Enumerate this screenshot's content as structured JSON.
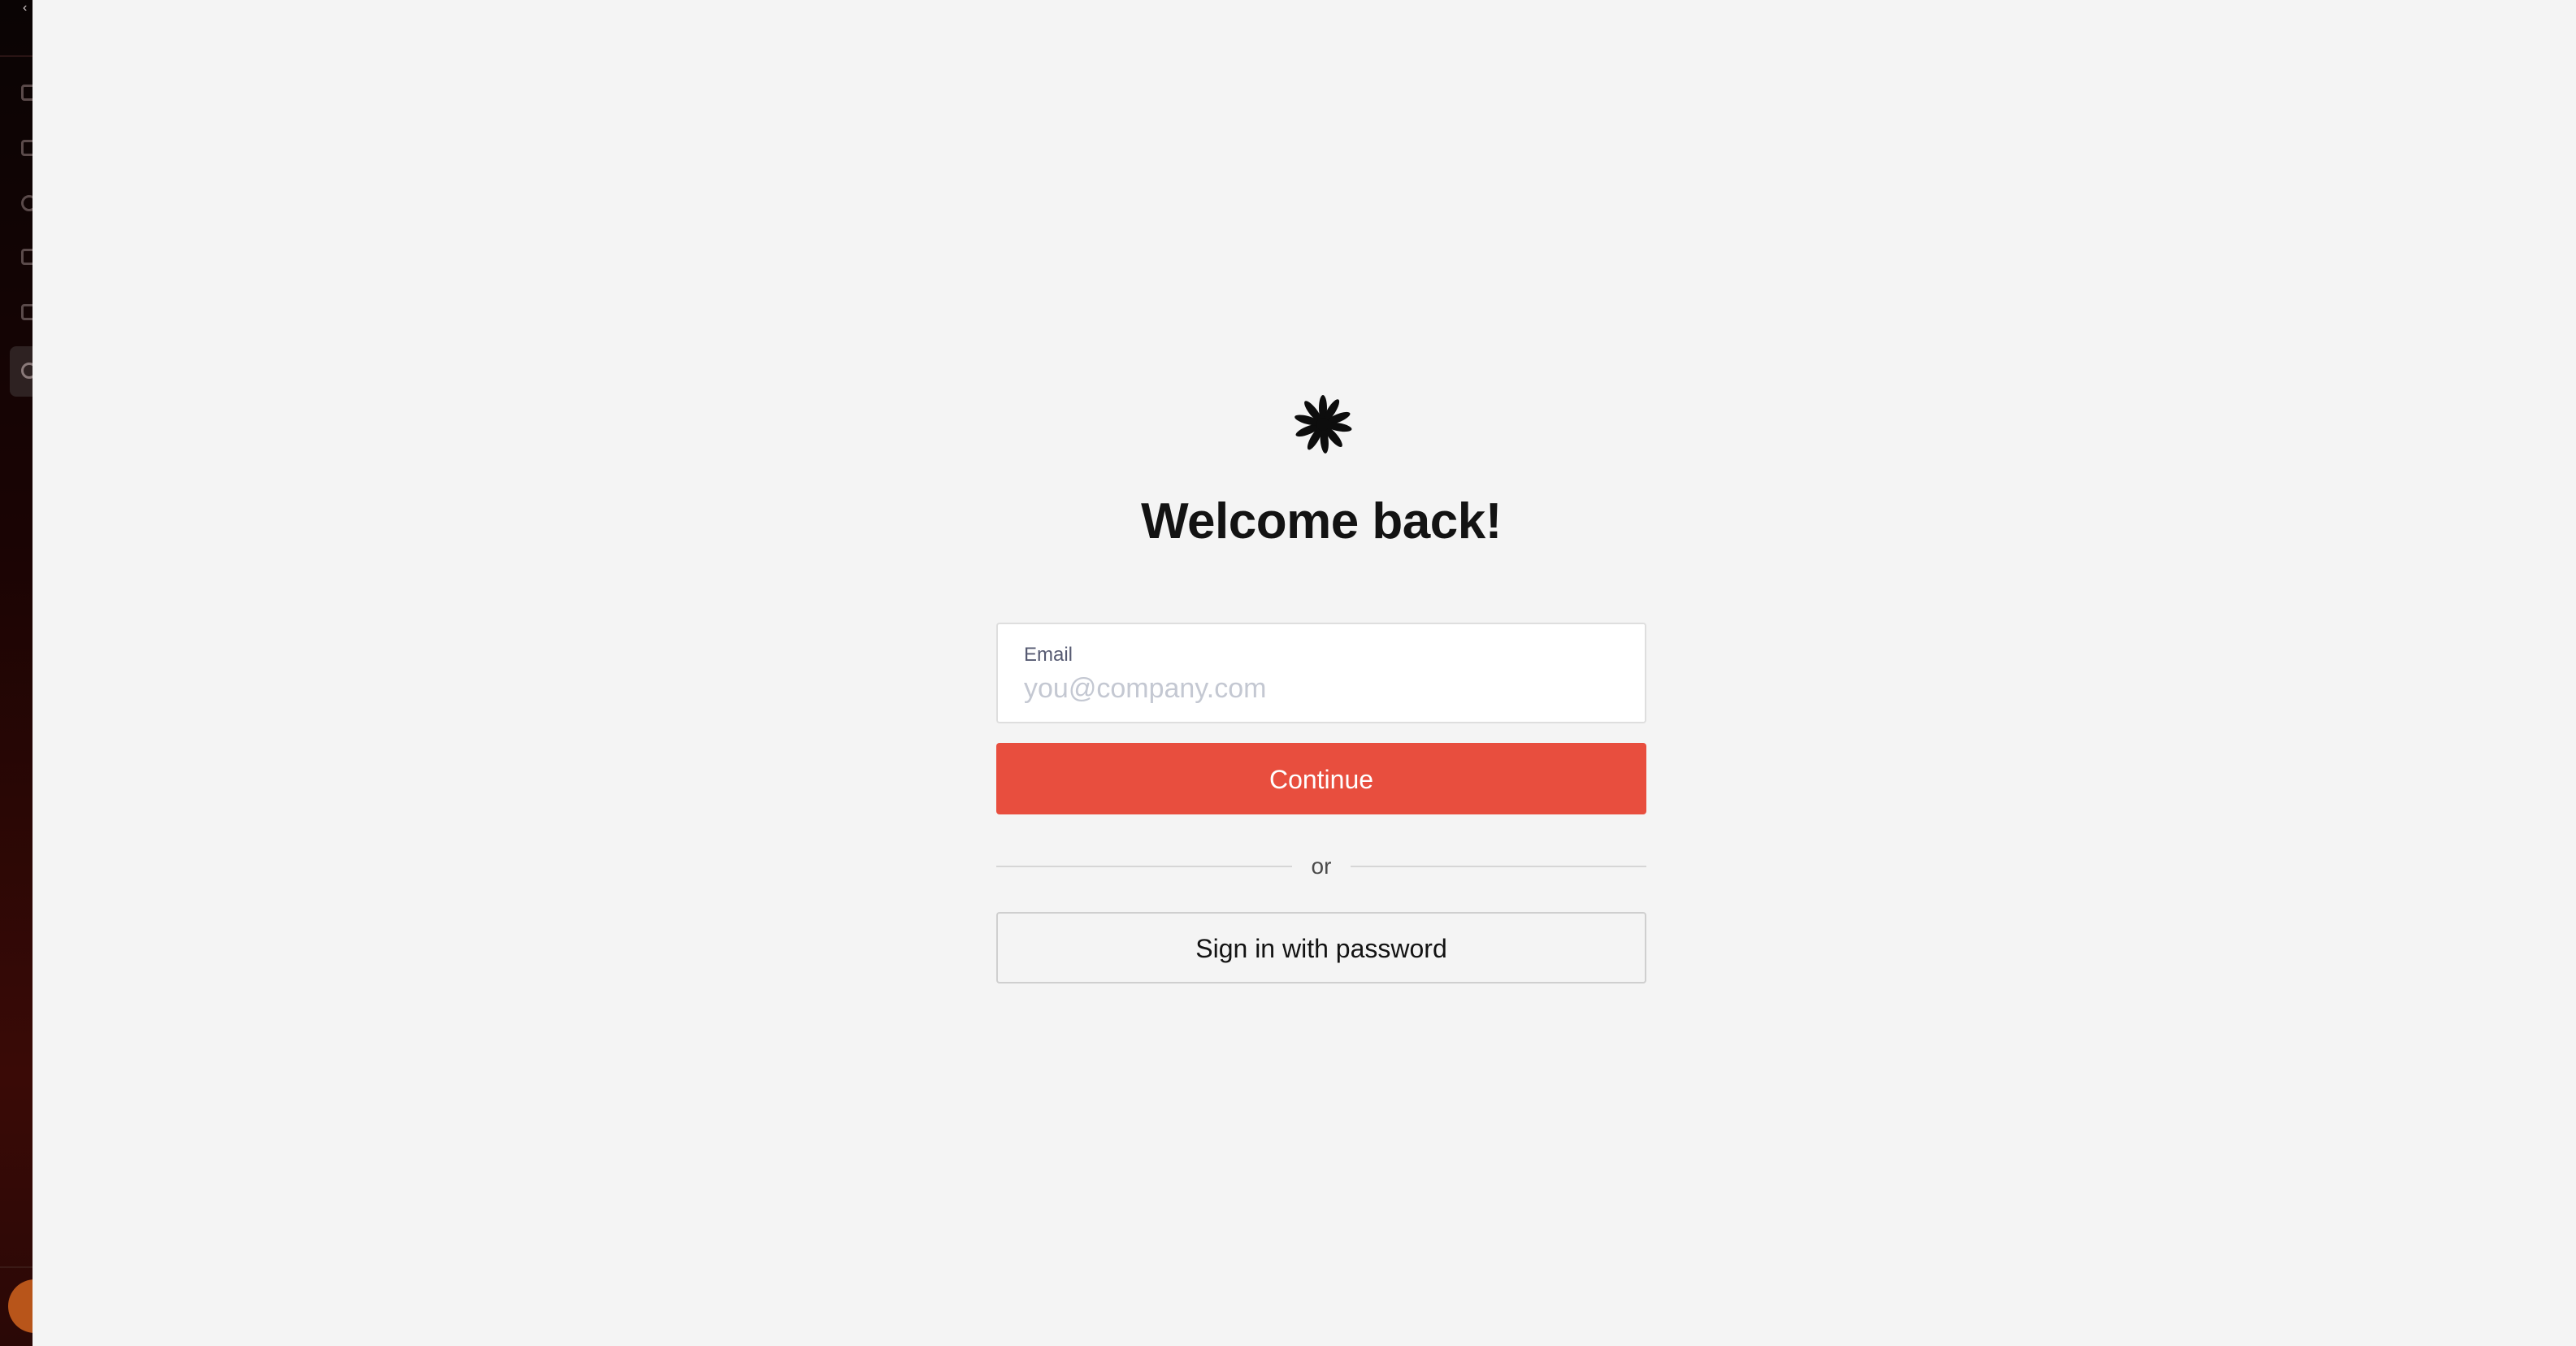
{
  "sidebar": {
    "back_icon": "chevron-left-icon",
    "nav_icons": [
      "building-icon",
      "grid-icon",
      "users-icon",
      "chart-icon",
      "calendar-icon",
      "settings-icon"
    ],
    "active_item_index": 5,
    "avatar_color": "#b8551a"
  },
  "login": {
    "logo_icon": "asterisk-logo-icon",
    "title": "Welcome back!",
    "email": {
      "label": "Email",
      "placeholder": "you@company.com",
      "value": ""
    },
    "continue_label": "Continue",
    "divider_text": "or",
    "password_button_label": "Sign in with password"
  },
  "colors": {
    "accent": "#e84e3e",
    "background": "#f4f4f4",
    "title_text": "#131313"
  }
}
